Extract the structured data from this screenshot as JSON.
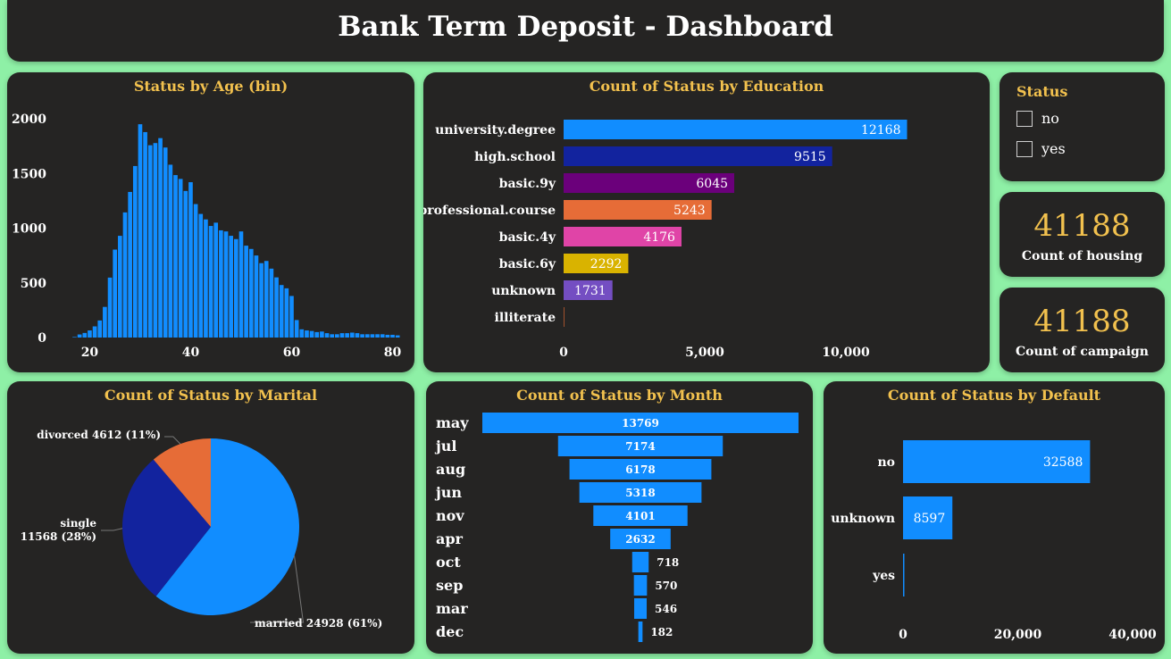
{
  "header": {
    "title": "Bank Term Deposit - Dashboard"
  },
  "colors": {
    "background": "#8ef0a6",
    "card": "#252423",
    "title": "#f2c14e",
    "blue": "#118dff",
    "navy": "#12239e"
  },
  "status_slicer": {
    "title": "Status",
    "options": [
      {
        "label": "no",
        "checked": false
      },
      {
        "label": "yes",
        "checked": false
      }
    ]
  },
  "kpis": {
    "housing": {
      "value": "41188",
      "label": "Count of housing"
    },
    "campaign": {
      "value": "41188",
      "label": "Count of campaign"
    }
  },
  "chart_data": [
    {
      "id": "age",
      "type": "bar",
      "title": "Status by Age (bin)",
      "xlabel": "",
      "ylabel": "",
      "x_ticks": [
        20,
        40,
        60,
        80
      ],
      "y_ticks": [
        0,
        500,
        1000,
        1500,
        2000
      ],
      "xlim": [
        15.5,
        81.5
      ],
      "ylim": [
        0,
        2000
      ],
      "x": [
        17,
        18,
        19,
        20,
        21,
        22,
        23,
        24,
        25,
        26,
        27,
        28,
        29,
        30,
        31,
        32,
        33,
        34,
        35,
        36,
        37,
        38,
        39,
        40,
        41,
        42,
        43,
        44,
        45,
        46,
        47,
        48,
        49,
        50,
        51,
        52,
        53,
        54,
        55,
        56,
        57,
        58,
        59,
        60,
        61,
        62,
        63,
        64,
        65,
        66,
        67,
        68,
        69,
        70,
        71,
        72,
        73,
        74,
        75,
        76,
        77,
        78,
        79,
        80,
        81
      ],
      "values": [
        5,
        28,
        42,
        65,
        102,
        156,
        280,
        548,
        804,
        930,
        1144,
        1331,
        1568,
        1950,
        1878,
        1758,
        1778,
        1823,
        1737,
        1580,
        1485,
        1450,
        1340,
        1420,
        1220,
        1130,
        1080,
        1020,
        1050,
        980,
        970,
        930,
        900,
        970,
        840,
        810,
        750,
        680,
        700,
        630,
        550,
        480,
        450,
        380,
        160,
        75,
        65,
        60,
        50,
        55,
        40,
        30,
        30,
        40,
        40,
        45,
        40,
        30,
        30,
        30,
        30,
        30,
        25,
        25,
        20
      ]
    },
    {
      "id": "education",
      "type": "bar",
      "orientation": "horizontal",
      "title": "Count of Status by Education",
      "categories": [
        "university.degree",
        "high.school",
        "basic.9y",
        "professional.course",
        "basic.4y",
        "basic.6y",
        "unknown",
        "illiterate"
      ],
      "values": [
        12168,
        9515,
        6045,
        5243,
        4176,
        2292,
        1731,
        18
      ],
      "labels": [
        "12168",
        "9515",
        "6045",
        "5243",
        "4176",
        "2292",
        "1731",
        ""
      ],
      "colors": [
        "#118dff",
        "#12239e",
        "#6b007b",
        "#e66c37",
        "#e044a7",
        "#d9b300",
        "#744ec2",
        "#a0522d"
      ],
      "x_ticks": [
        "0",
        "5,000",
        "10,000"
      ],
      "xlim": [
        0,
        14000
      ]
    },
    {
      "id": "marital",
      "type": "pie",
      "title": "Count of Status by Marital",
      "slices": [
        {
          "name": "married",
          "value": 24928,
          "label": "married 24928 (61%)",
          "color": "#118dff"
        },
        {
          "name": "single",
          "value": 11568,
          "label_line1": "single",
          "label_line2": "11568 (28%)",
          "color": "#12239e"
        },
        {
          "name": "divorced",
          "value": 4612,
          "label": "divorced 4612 (11%)",
          "color": "#e66c37"
        }
      ]
    },
    {
      "id": "month",
      "type": "bar",
      "orientation": "funnel",
      "title": "Count of Status by Month",
      "categories": [
        "may",
        "jul",
        "aug",
        "jun",
        "nov",
        "apr",
        "oct",
        "sep",
        "mar",
        "dec"
      ],
      "values": [
        13769,
        7174,
        6178,
        5318,
        4101,
        2632,
        718,
        570,
        546,
        182
      ],
      "labels": [
        "13769",
        "7174",
        "6178",
        "5318",
        "4101",
        "2632",
        "718",
        "570",
        "546",
        "182"
      ]
    },
    {
      "id": "default",
      "type": "bar",
      "orientation": "horizontal",
      "title": "Count of Status by Default",
      "categories": [
        "no",
        "unknown",
        "yes"
      ],
      "values": [
        32588,
        8597,
        3
      ],
      "labels": [
        "32588",
        "8597",
        ""
      ],
      "x_ticks": [
        "0",
        "20,000",
        "40,000"
      ],
      "xlim": [
        0,
        40000
      ]
    }
  ]
}
